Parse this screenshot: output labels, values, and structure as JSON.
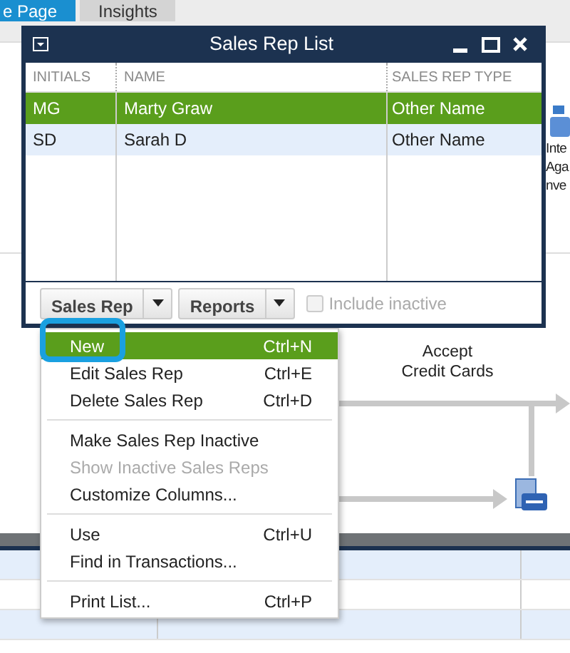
{
  "tabs": [
    {
      "label": "e Page",
      "selected": true
    },
    {
      "label": "Insights",
      "selected": false
    }
  ],
  "background": {
    "side_text": [
      "Inte",
      "Aga",
      "nve"
    ],
    "accept_label": [
      "Accept",
      "Credit Cards"
    ]
  },
  "window": {
    "title": "Sales Rep List",
    "columns": [
      "INITIALS",
      "NAME",
      "SALES REP TYPE"
    ],
    "rows": [
      {
        "cells": [
          "MG",
          "Marty Graw",
          "Other Name"
        ],
        "selected": true
      },
      {
        "cells": [
          "SD",
          "Sarah D",
          "Other Name"
        ],
        "selected": false
      }
    ],
    "buttons": [
      "Sales Rep",
      "Reports"
    ],
    "include_inactive": {
      "label": "Include inactive",
      "checked": false,
      "disabled": true
    }
  },
  "menu": {
    "groups": [
      [
        {
          "label": "New",
          "shortcut": "Ctrl+N",
          "selected": true,
          "disabled": false,
          "highlighted": true
        },
        {
          "label": "Edit Sales Rep",
          "shortcut": "Ctrl+E",
          "selected": false,
          "disabled": false,
          "highlighted": false
        },
        {
          "label": "Delete Sales Rep",
          "shortcut": "Ctrl+D",
          "selected": false,
          "disabled": false,
          "highlighted": false
        }
      ],
      [
        {
          "label": "Make Sales Rep Inactive",
          "selected": false,
          "disabled": false,
          "highlighted": false
        },
        {
          "label": "Show Inactive Sales Reps",
          "selected": false,
          "disabled": true,
          "highlighted": false
        },
        {
          "label": "Customize Columns...",
          "selected": false,
          "disabled": false,
          "highlighted": false
        }
      ],
      [
        {
          "label": "Use",
          "shortcut": "Ctrl+U",
          "selected": false,
          "disabled": false,
          "highlighted": false
        },
        {
          "label": "Find in Transactions...",
          "selected": false,
          "disabled": false,
          "highlighted": false
        }
      ],
      [
        {
          "label": "Print List...",
          "shortcut": "Ctrl+P",
          "selected": false,
          "disabled": false,
          "highlighted": false
        }
      ]
    ]
  }
}
